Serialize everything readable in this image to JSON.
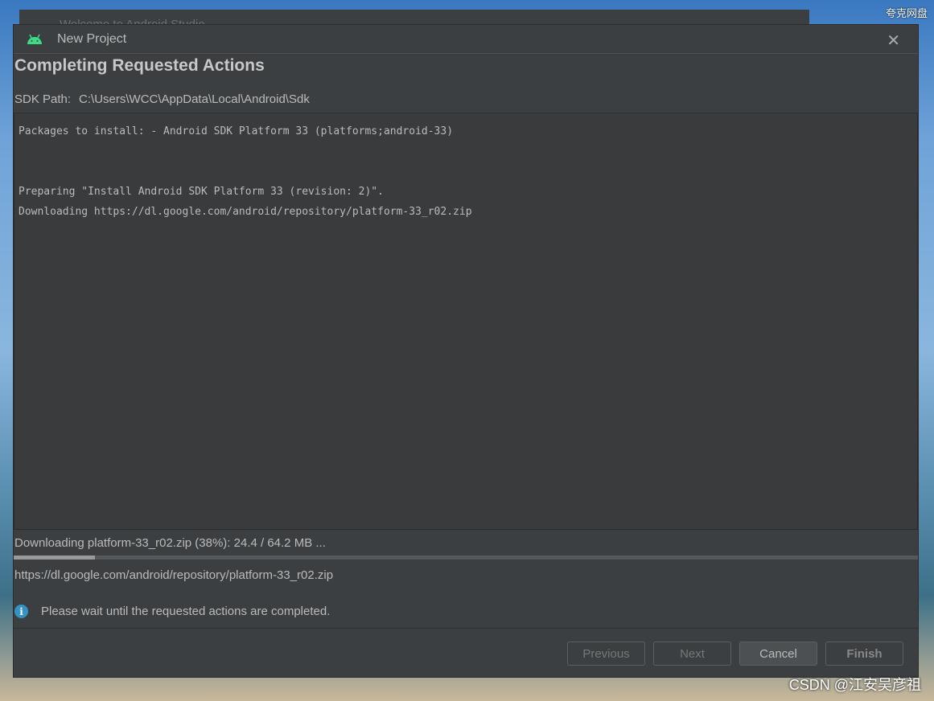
{
  "desktop": {
    "top_right_label": "夸克网盘",
    "watermark": "CSDN @江安吴彦祖"
  },
  "background_window": {
    "title": "Welcome to Android Studio"
  },
  "dialog": {
    "title": "New Project",
    "heading": "Completing Requested Actions",
    "sdk_label": "SDK Path:",
    "sdk_path": "C:\\Users\\WCC\\AppData\\Local\\Android\\Sdk",
    "log": [
      "Packages to install: - Android SDK Platform 33 (platforms;android-33)",
      "",
      "",
      "Preparing \"Install Android SDK Platform 33 (revision: 2)\".",
      "Downloading https://dl.google.com/android/repository/platform-33_r02.zip"
    ],
    "status": "Downloading platform-33_r02.zip (38%): 24.4 / 64.2 MB ...",
    "progress_fill": 0.09,
    "url": "https://dl.google.com/android/repository/platform-33_r02.zip",
    "info": "Please wait until the requested actions are completed.",
    "buttons": {
      "previous": "Previous",
      "next": "Next",
      "cancel": "Cancel",
      "finish": "Finish"
    }
  },
  "colors": {
    "android_green": "#3ddc84",
    "info_blue": "#3592c4",
    "dialog_bg": "#3c3f41"
  }
}
